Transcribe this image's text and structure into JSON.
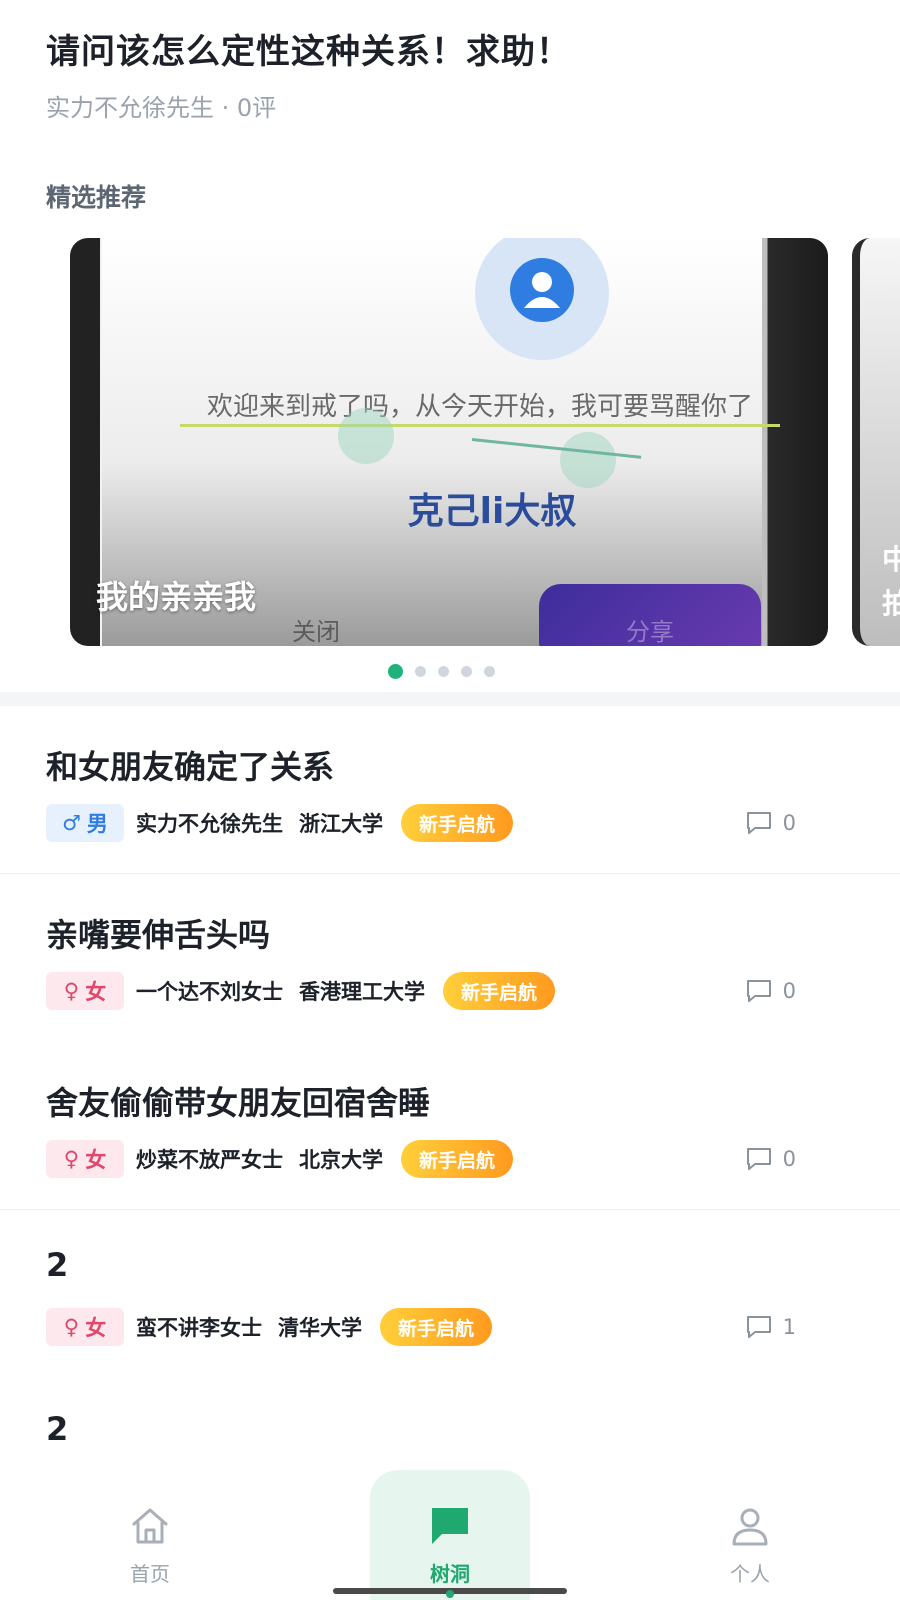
{
  "top_post": {
    "title": "请问该怎么定性这种关系！求助！",
    "meta": "实力不允徐先生 · 0评"
  },
  "featured": {
    "section_title": "精选推荐",
    "card": {
      "welcome_text": "欢迎来到戒了吗，从今天开始，我可要骂醒你了",
      "nickname": "克己li大叔",
      "close_label": "关闭",
      "share_label": "分享",
      "caption": "我的亲亲我"
    },
    "next_card_caption": "中拍",
    "pagination": {
      "total": 5,
      "active_index": 0
    }
  },
  "posts": [
    {
      "title": "和女朋友确定了关系",
      "gender_symbol": "♂",
      "gender_label": "男",
      "gender_type": "male",
      "author": "实力不允徐先生",
      "school": "浙江大学",
      "badge": "新手启航",
      "comment_count": "0"
    },
    {
      "title": "亲嘴要伸舌头吗",
      "gender_symbol": "♀",
      "gender_label": "女",
      "gender_type": "female",
      "author": "一个达不刘女士",
      "school": "香港理工大学",
      "badge": "新手启航",
      "comment_count": "0"
    },
    {
      "title": "舍友偷偷带女朋友回宿舍睡",
      "gender_symbol": "♀",
      "gender_label": "女",
      "gender_type": "female",
      "author": "炒菜不放严女士",
      "school": "北京大学",
      "badge": "新手启航",
      "comment_count": "0"
    },
    {
      "title": "2",
      "gender_symbol": "♀",
      "gender_label": "女",
      "gender_type": "female",
      "author": "蛮不讲李女士",
      "school": "清华大学",
      "badge": "新手启航",
      "comment_count": "1"
    }
  ],
  "partial_post_title": "2",
  "tabbar": {
    "items": [
      {
        "label": "首页",
        "icon": "home-icon",
        "active": false
      },
      {
        "label": "树洞",
        "icon": "chat-bubble-icon",
        "active": true
      },
      {
        "label": "个人",
        "icon": "person-icon",
        "active": false
      }
    ]
  },
  "colors": {
    "accent": "#1fa86f",
    "male": "#2f7de1",
    "female": "#e2466c",
    "badge_from": "#ffcf3a",
    "badge_to": "#ff9a1f"
  }
}
